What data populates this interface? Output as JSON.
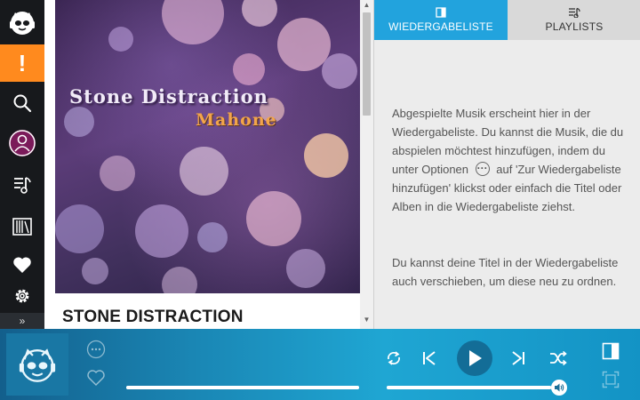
{
  "sidebar": {
    "alert_label": "!",
    "expand_label": "»",
    "icons": [
      "napster-logo-icon",
      "alert-icon",
      "search-icon",
      "profile-icon",
      "music-queue-icon",
      "library-icon",
      "heart-icon",
      "gear-icon",
      "expand-icon"
    ],
    "active_color": "#ff8a1e",
    "background_color": "#17191c"
  },
  "album": {
    "cover_title": "Stone Distraction",
    "cover_artist": "Mahone",
    "name": "STONE DISTRACTION"
  },
  "tabs": {
    "queue_label": "WIEDERGABELISTE",
    "playlists_label": "PLAYLISTS",
    "active_color": "#22a3dd"
  },
  "queue": {
    "paragraph1_before": "Abgespielte Musik erscheint hier in der Wiedergabeliste. Du kannst die Musik, die du abspielen möchtest hinzufügen, indem du unter Optionen",
    "paragraph1_after": "auf 'Zur Wiedergabeliste hinzufügen' klickst oder einfach die Titel oder Alben in die Wiedergabeliste ziehst.",
    "paragraph2": "Du kannst deine Titel in der Wiedergabeliste auch verschieben, um diese neu zu ordnen."
  },
  "player": {
    "progress_fraction": 1.0,
    "volume_fraction": 0.96,
    "controls": [
      "more-options-icon",
      "heart-icon",
      "repeat-icon",
      "previous-icon",
      "play-icon",
      "next-icon",
      "shuffle-icon",
      "panel-toggle-icon",
      "fullscreen-icon",
      "volume-icon"
    ]
  }
}
